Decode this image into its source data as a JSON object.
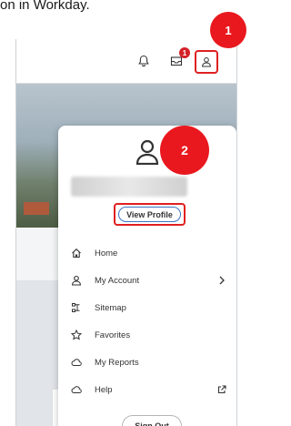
{
  "doc": {
    "text": "on in Workday."
  },
  "topbar": {
    "notification_badge": "1"
  },
  "profile_menu": {
    "view_profile_label": "View Profile",
    "items": [
      {
        "label": "Home",
        "icon": "home-icon"
      },
      {
        "label": "My Account",
        "icon": "user-icon",
        "trailing_icon": "chevron-right-icon"
      },
      {
        "label": "Sitemap",
        "icon": "sitemap-icon"
      },
      {
        "label": "Favorites",
        "icon": "star-icon"
      },
      {
        "label": "My Reports",
        "icon": "cloud-icon"
      },
      {
        "label": "Help",
        "icon": "cloud-icon",
        "trailing_icon": "external-link-icon"
      }
    ],
    "sign_out_label": "Sign Out"
  },
  "callouts": [
    "1",
    "2"
  ],
  "colors": {
    "callout": "#e9181e",
    "highlight_border": "#e02020",
    "view_profile_border": "#3a75c4",
    "badge": "#d42127"
  }
}
